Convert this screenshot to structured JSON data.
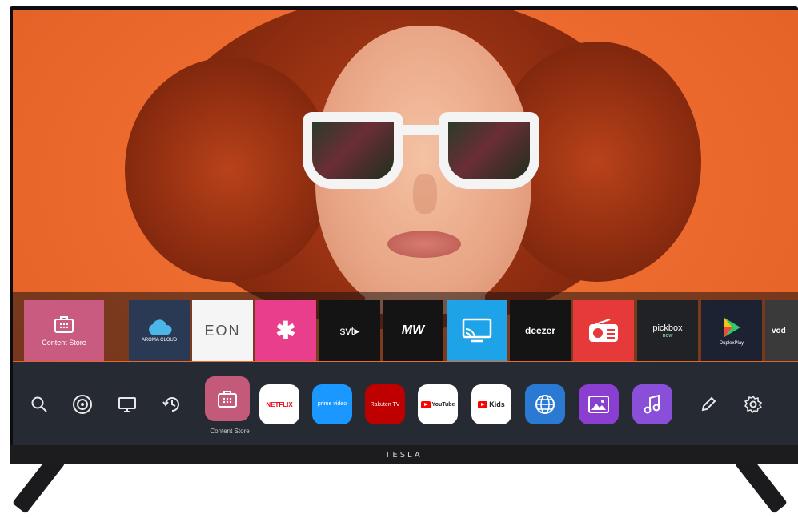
{
  "device": {
    "brand": "TESLA"
  },
  "app_row": {
    "items": [
      {
        "id": "content-store",
        "label": "Content Store"
      },
      {
        "id": "aroma-cloud",
        "label": "AROMA CLOUD"
      },
      {
        "id": "eon",
        "label": "EON"
      },
      {
        "id": "star-app",
        "label": "✱"
      },
      {
        "id": "svt-play",
        "label": "svt▸"
      },
      {
        "id": "mw",
        "label": "MW"
      },
      {
        "id": "screen-cast",
        "label": ""
      },
      {
        "id": "deezer",
        "label": "deezer"
      },
      {
        "id": "radio",
        "label": ""
      },
      {
        "id": "pickbox",
        "label": "pickbox",
        "sub": "now"
      },
      {
        "id": "duplexplay",
        "label": "DuplexPlay"
      },
      {
        "id": "vod",
        "label": "vod"
      }
    ]
  },
  "launcher": {
    "store_label": "Content Store",
    "apps": [
      {
        "id": "netflix",
        "label": "NETFLIX"
      },
      {
        "id": "prime-video",
        "label": "prime video"
      },
      {
        "id": "rakuten",
        "label": "Rakuten TV"
      },
      {
        "id": "youtube",
        "label": "YouTube"
      },
      {
        "id": "youtube-kids",
        "label": "Kids"
      }
    ]
  },
  "colors": {
    "screen_bg": "#ec6a2e",
    "launcher_bg": "#262a33",
    "content_store": "#c45a7a",
    "netflix_red": "#e50914"
  }
}
